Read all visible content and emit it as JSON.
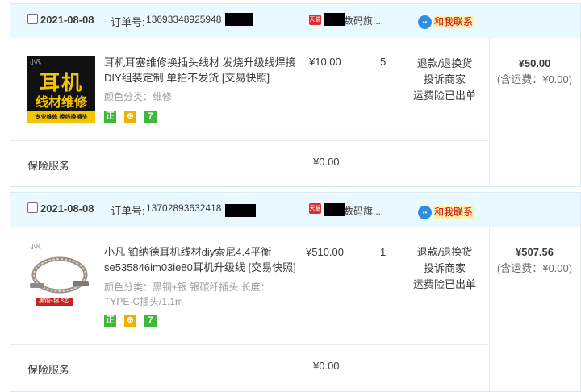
{
  "orders": [
    {
      "date": "2021-08-08",
      "order_label": "订单号:",
      "order_no": "13693348925948",
      "shop_badge": "天猫",
      "shop_name": "数码旗...",
      "contact_label": "和我联系",
      "thumb": {
        "brand": "小凡",
        "line1": "耳机",
        "line2": "线材维修",
        "bar": "专业维修 换线换插头"
      },
      "title": "耳机耳塞维修换插头线材 发烧升级线焊接DIY组装定制 单拍不发货 [交易快照]",
      "attr": "颜色分类：维修",
      "badges": [
        "正",
        "⊕",
        "7"
      ],
      "price": "¥10.00",
      "qty": "5",
      "ops": [
        "退款/退换货",
        "投诉商家",
        "运费险已出单"
      ],
      "total": "¥50.00",
      "shipping": "(含运费：¥0.00)",
      "service_label": "保险服务",
      "service_price": "¥0.00"
    },
    {
      "date": "2021-08-08",
      "order_label": "订单号:",
      "order_no": "13702893632418",
      "shop_badge": "天猫",
      "shop_name": "数码旗...",
      "contact_label": "和我联系",
      "thumb": {
        "brand": "小凡",
        "caption": "黑铜+银 8芯"
      },
      "title": "小凡 铂纳德耳机线材diy索尼4.4平衡se535846im03ie80耳机升级线 [交易快照]",
      "attr": "颜色分类：黑铜+银 银碳纤插头  长度：TYPE-C插头/1.1m",
      "badges": [
        "正",
        "⊕",
        "7"
      ],
      "price": "¥510.00",
      "qty": "1",
      "ops": [
        "退款/退换货",
        "投诉商家",
        "运费险已出单"
      ],
      "total": "¥507.56",
      "shipping": "(含运费：¥0.00)",
      "service_label": "保险服务",
      "service_price": "¥0.00"
    }
  ],
  "colors": {
    "header_bg": "#eaf8ff",
    "border": "#d9e9f4",
    "badge_green": "#3fb73a",
    "contact_bg": "#fff1a8",
    "contact_text": "#c80000"
  }
}
